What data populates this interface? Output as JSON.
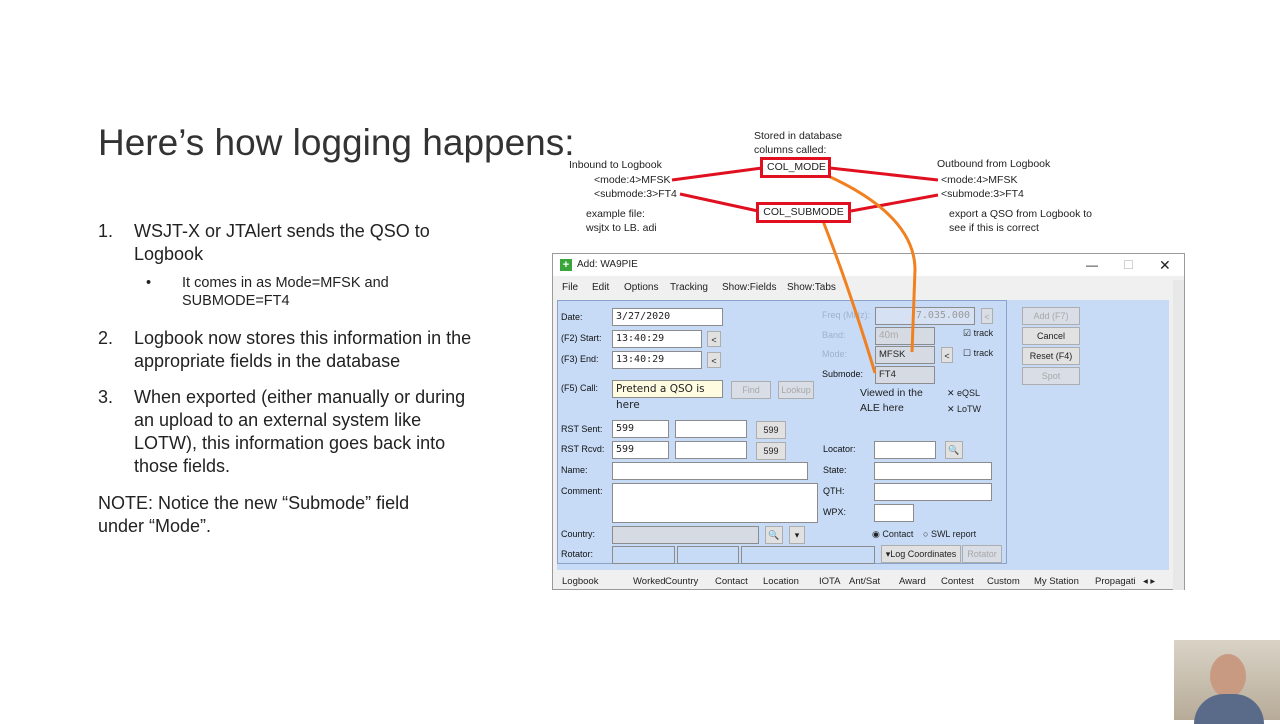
{
  "slide": {
    "title": "Here’s how logging happens:",
    "items": [
      {
        "num": "1.",
        "text": "WSJT-X or JTAlert sends the QSO to Logbook",
        "sub": {
          "bullet": "•",
          "text": "It comes in as Mode=MFSK and SUBMODE=FT4"
        }
      },
      {
        "num": "2.",
        "text": "Logbook now stores this information in the appropriate fields in the database"
      },
      {
        "num": "3.",
        "text": "When exported (either manually or during an upload to an external system like LOTW), this information goes back into those fields."
      }
    ],
    "note": "NOTE: Notice the new “Submode” field under “Mode”."
  },
  "annotations": {
    "stored": "Stored in database columns called:",
    "col_mode": "COL_MODE",
    "col_submode": "COL_SUBMODE",
    "inbound_title": "Inbound to Logbook",
    "inbound_mode": "<mode:4>MFSK",
    "inbound_submode": "<submode:3>FT4",
    "example": "example file: wsjtx to LB. adi",
    "outbound_title": "Outbound from Logbook",
    "outbound_mode": "<mode:4>MFSK",
    "outbound_submode": "<submode:3>FT4",
    "export_note": "export a QSO from Logbook to see if this is correct",
    "viewed": "Viewed in the ALE here",
    "colors": {
      "box": "#e01020",
      "arrow": "#f08020"
    }
  },
  "window": {
    "title": "Add: WA9PIE",
    "menu": [
      "File",
      "Edit",
      "Options",
      "Tracking",
      "Show:Fields",
      "Show:Tabs"
    ],
    "labels": {
      "date": "Date:",
      "start": "(F2) Start:",
      "end": "(F3) End:",
      "call": "(F5) Call:",
      "rst_sent": "RST Sent:",
      "rst_rcvd": "RST Rcvd:",
      "name": "Name:",
      "comment": "Comment:",
      "country": "Country:",
      "rotator": "Rotator:",
      "freq": "Freq (MHz):",
      "band": "Band:",
      "mode": "Mode:",
      "submode": "Submode:",
      "locator": "Locator:",
      "state": "State:",
      "qth": "QTH:",
      "wpx": "WPX:"
    },
    "values": {
      "date": "3/27/2020",
      "start": "13:40:29",
      "end": "13:40:29",
      "call": "Pretend a QSO is here",
      "rst_sent": "599",
      "rst_rcvd": "599",
      "rst_sent_btn": "599",
      "rst_rcvd_btn": "599",
      "freq": "7.035.000",
      "band": "40m",
      "mode": "MFSK",
      "submode": "FT4"
    },
    "buttons": {
      "find": "Find",
      "lookup": "Lookup",
      "add": "Add (F7)",
      "cancel": "Cancel",
      "reset": "Reset (F4)",
      "spot": "Spot",
      "log_coords": "▾Log Coordinates",
      "rotator": "Rotator",
      "back": "<"
    },
    "checks": {
      "band_track": "track",
      "band_track_checked": true,
      "mode_track": "track",
      "mode_track_checked": false,
      "eqsl": "eQSL",
      "lotw": "LoTW"
    },
    "radios": {
      "contact": "Contact",
      "swl": "SWL report",
      "selected": "Contact"
    },
    "tabs": [
      "Logbook",
      "Worked",
      "Country",
      "Contact",
      "Location",
      "IOTA",
      "Ant/Sat",
      "Award",
      "Contest",
      "Custom",
      "My Station",
      "Propagati"
    ]
  }
}
